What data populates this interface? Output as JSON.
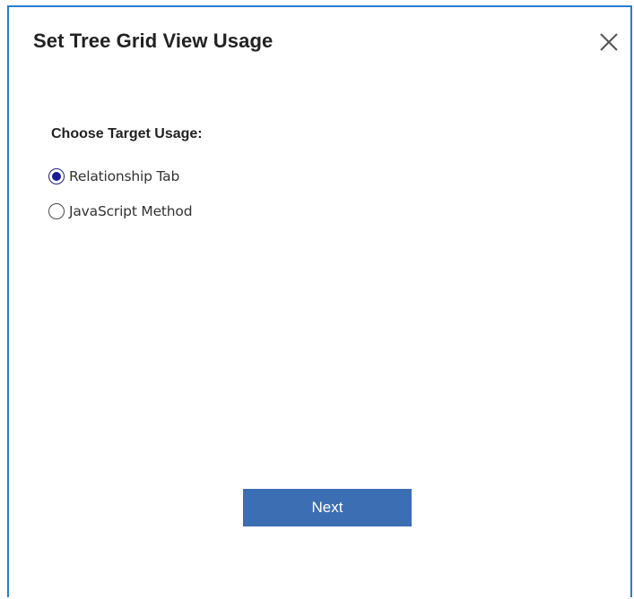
{
  "dialog": {
    "title": "Set Tree Grid View Usage",
    "close_icon": "close-icon",
    "accent_border_color": "#2a7bd1"
  },
  "form": {
    "label": "Choose Target Usage:",
    "options": [
      {
        "label": "Relationship Tab",
        "checked": true
      },
      {
        "label": "JavaScript Method",
        "checked": false
      }
    ]
  },
  "actions": {
    "next_label": "Next",
    "next_color": "#3c6eb4"
  }
}
